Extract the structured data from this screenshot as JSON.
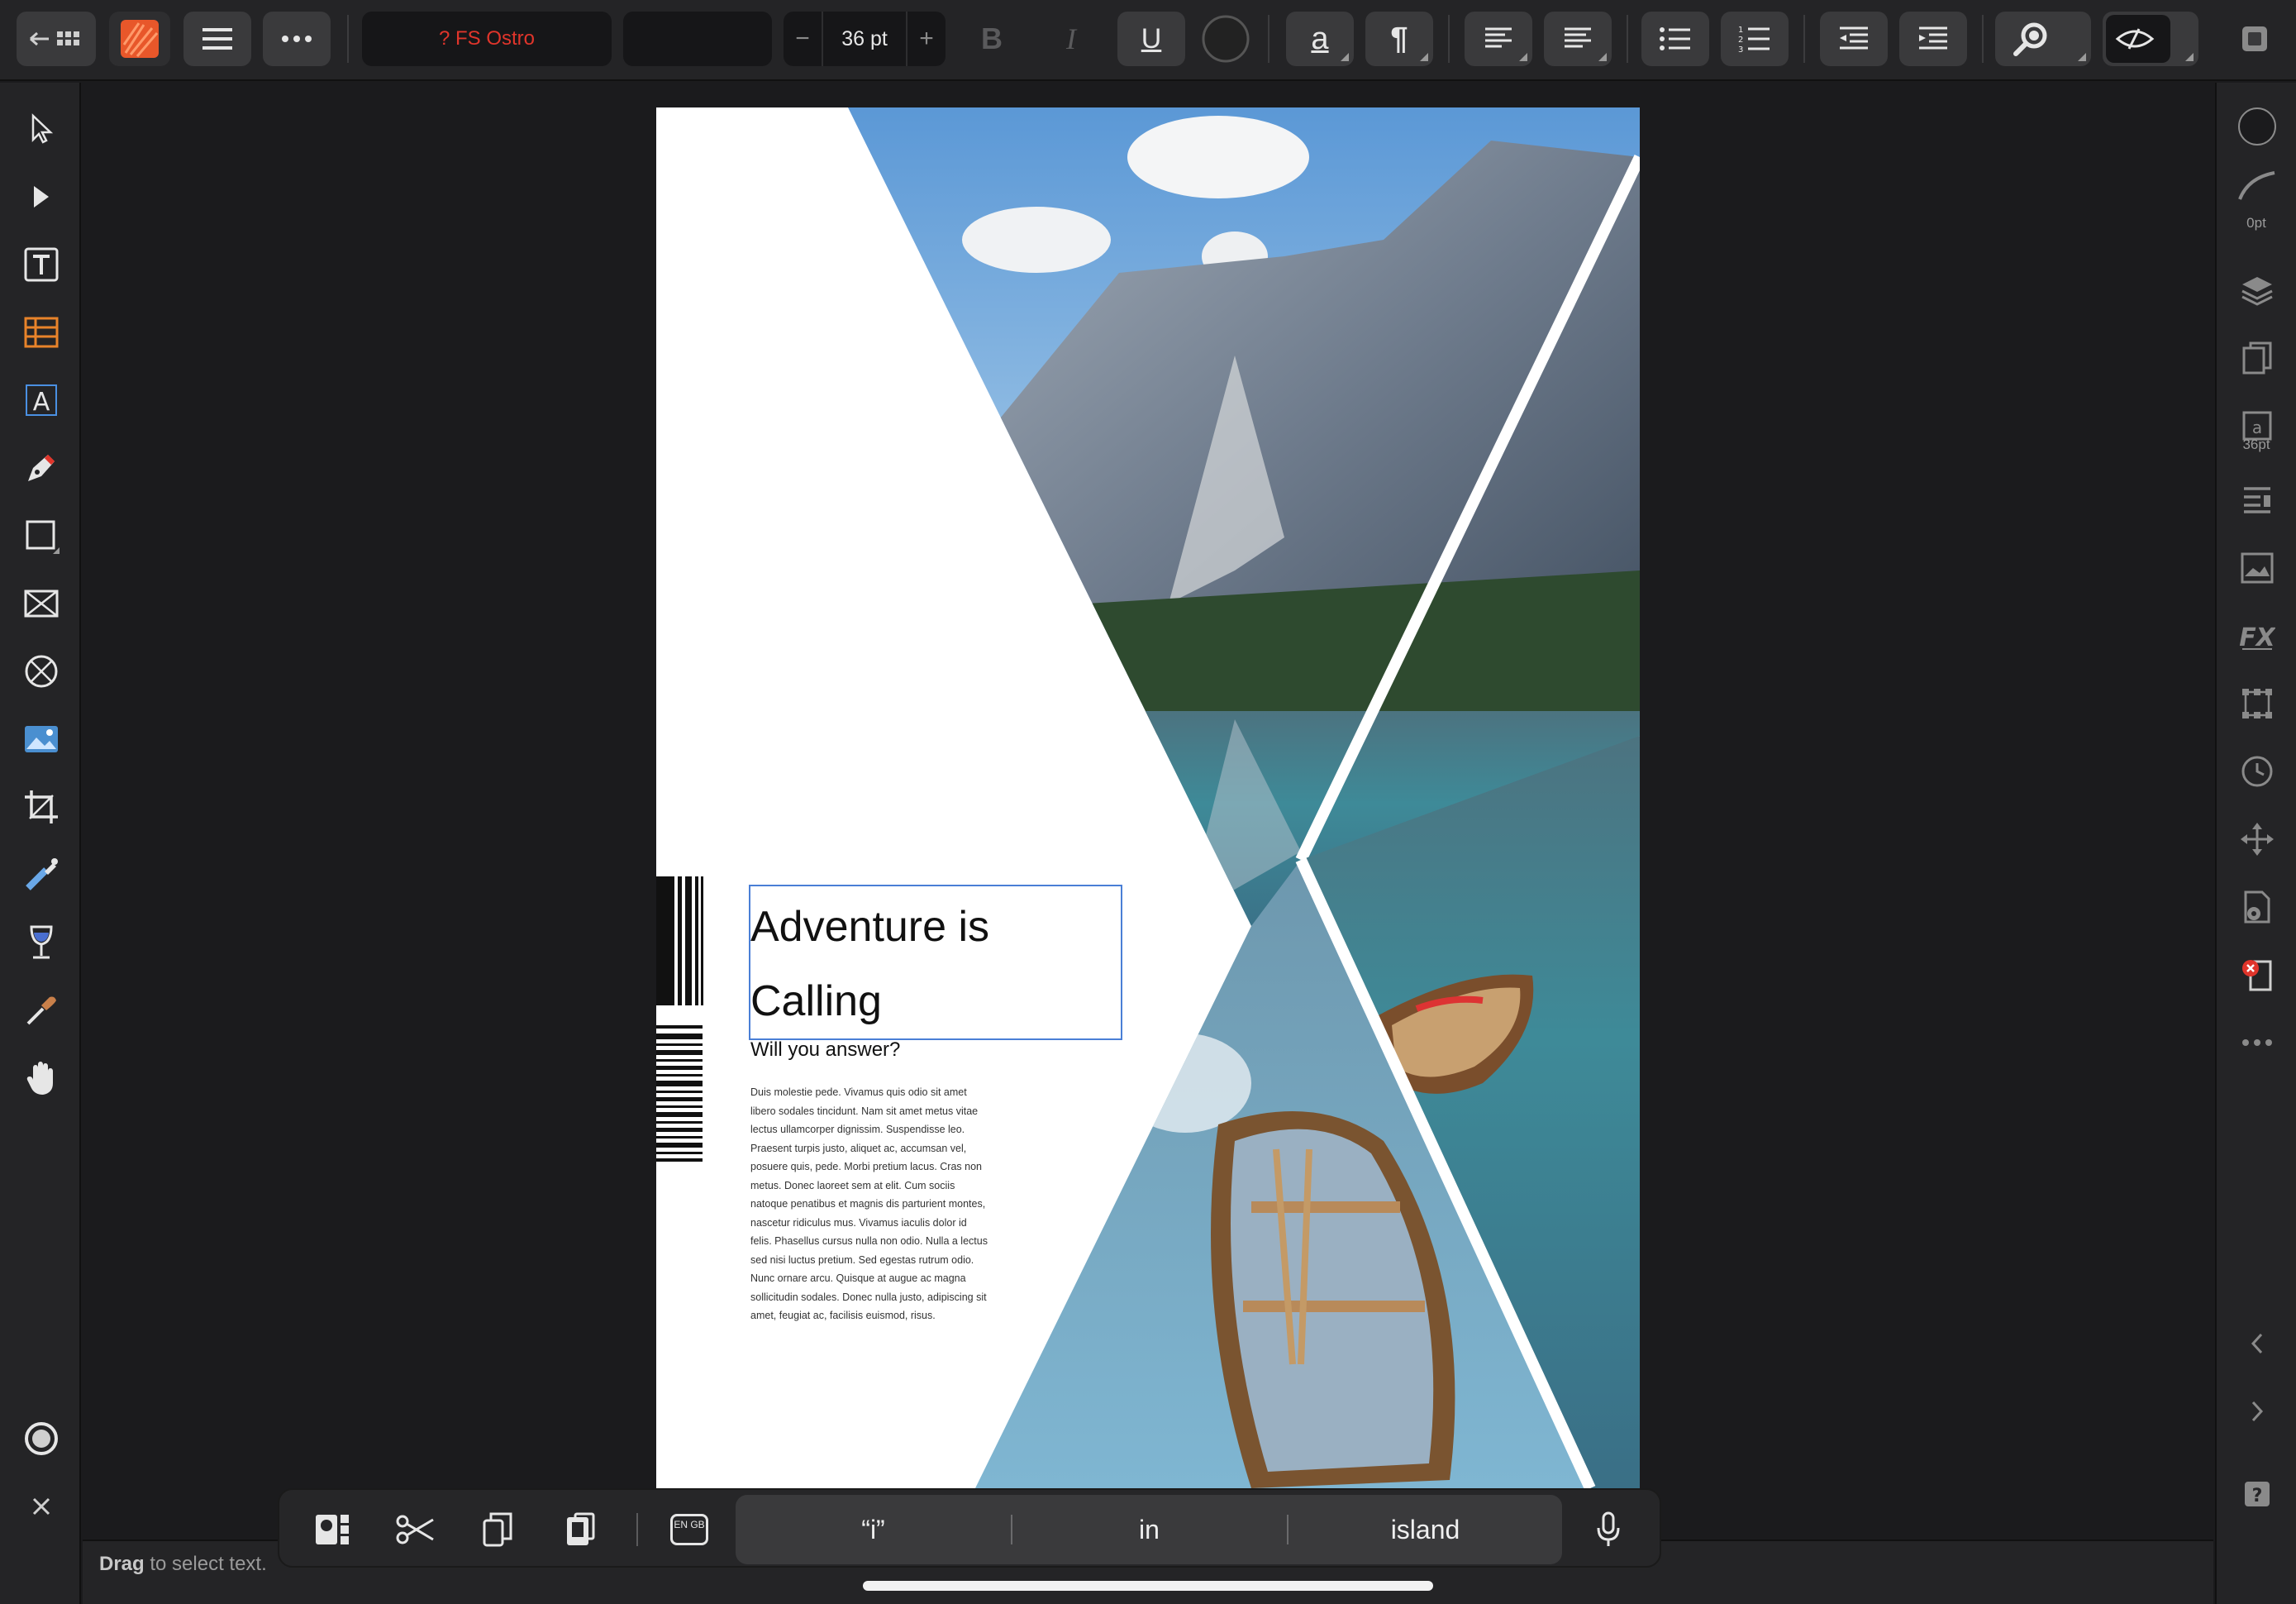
{
  "toolbar": {
    "font_name": "? FS Ostro",
    "font_style": "",
    "font_size": "36 pt",
    "decrease_label": "−",
    "increase_label": "+",
    "bold_label": "B",
    "italic_label": "I",
    "underline_label": "U",
    "char_label": "a",
    "para_label": "¶"
  },
  "document": {
    "headline_line1": "Adventure is",
    "headline_line2": "Calling",
    "subheading": "Will you answer?",
    "body": "Duis molestie pede. Vivamus quis odio sit amet libero sodales tincidunt. Nam sit amet metus vitae lectus ullamcorper dignissim. Suspendisse leo. Praesent turpis justo, aliquet ac, accumsan vel, posuere quis, pede. Morbi pretium lacus. Cras non metus. Donec laoreet sem at elit. Cum sociis natoque penatibus et magnis dis parturient montes, nascetur ridiculus mus. Vivamus iaculis dolor id felis. Phasellus cursus nulla non odio. Nulla a lectus sed nisi luctus pretium. Sed egestas rutrum odio. Nunc ornare arcu. Quisque at augue ac magna sollicitudin sodales. Donec nulla justo, adipiscing sit amet, feugiat ac, facilisis euismod, risus."
  },
  "studio": {
    "stroke_width": "0pt",
    "text_size": "36pt"
  },
  "status": {
    "hint_bold": "Drag",
    "hint_rest": " to select text."
  },
  "keyboard": {
    "lang_label": "EN GB",
    "predictions": [
      "“i”",
      "in",
      "island"
    ]
  },
  "colors": {
    "accent": "#4a7fd6",
    "font_missing": "#e0352b",
    "app_icon": "#e8572a"
  }
}
